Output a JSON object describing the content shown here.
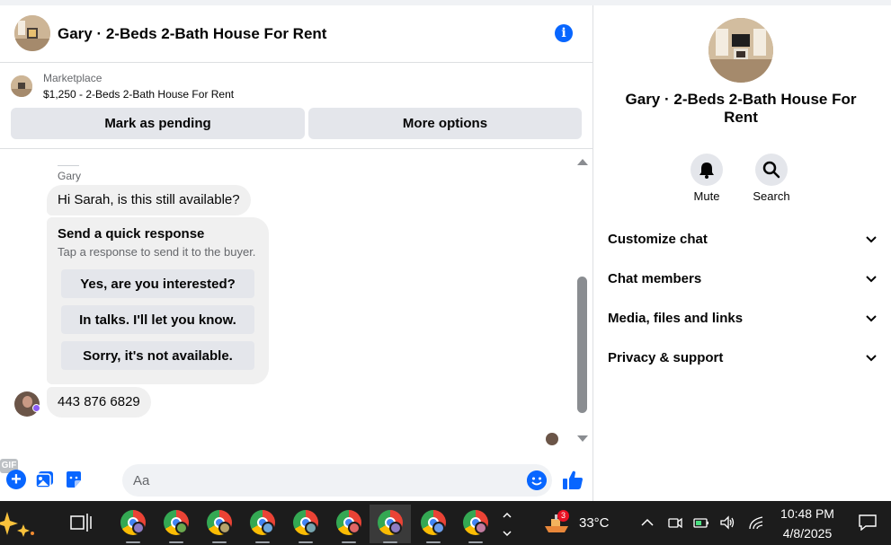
{
  "header": {
    "title": "Gary · 2-Beds 2-Bath House For Rent"
  },
  "marketplace": {
    "label": "Marketplace",
    "listing": "$1,250 - 2-Beds 2-Bath House For Rent",
    "mark_pending": "Mark as pending",
    "more_options": "More options"
  },
  "messages": {
    "sender_name": "Gary",
    "first_message": "Hi Sarah, is this still available?",
    "quick_response": {
      "title": "Send a quick response",
      "subtitle": "Tap a response to send it to the buyer.",
      "options": [
        "Yes, are you interested?",
        "In talks. I'll let you know.",
        "Sorry, it's not available."
      ]
    },
    "reply": "443 876 6829"
  },
  "composer": {
    "placeholder": "Aa",
    "gif_label": "GIF"
  },
  "side": {
    "name": "Gary · 2-Beds 2-Bath House For Rent",
    "actions": {
      "mute": "Mute",
      "search": "Search"
    },
    "sections": [
      "Customize chat",
      "Chat members",
      "Media, files and links",
      "Privacy & support"
    ]
  },
  "taskbar": {
    "weather_badge": "3",
    "temperature": "33°C",
    "time": "10:48 PM",
    "date": "4/8/2025",
    "profile_colors": [
      "#8e7cc3",
      "#6aa84f",
      "#b6a36b",
      "#6fa8dc",
      "#76a5af",
      "#e06666",
      "#8e7cc3",
      "#6d9eeb",
      "#c27ba0"
    ]
  },
  "colors": {
    "accent": "#0866ff",
    "bubble": "#f0f0f0",
    "button": "#e4e6eb"
  }
}
